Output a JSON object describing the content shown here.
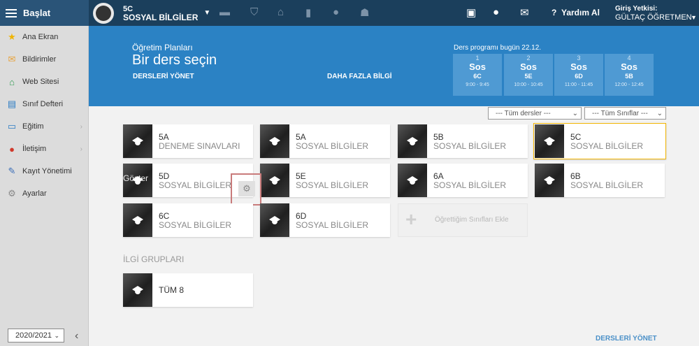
{
  "brand": {
    "label": "Başlat"
  },
  "header": {
    "class_code": "5C",
    "class_subject": "SOSYAL BİLGİLER",
    "help_label": "Yardım Al",
    "user_role": "Giriş Yetkisi:",
    "user_name": "GÜLTAÇ ÖĞRETMEN"
  },
  "sidebar": {
    "items": [
      {
        "label": "Ana Ekran",
        "icon": "star-icon"
      },
      {
        "label": "Bildirimler",
        "icon": "envelope-icon"
      },
      {
        "label": "Web Sitesi",
        "icon": "home-icon"
      },
      {
        "label": "Sınıf Defteri",
        "icon": "notebook-icon"
      },
      {
        "label": "Eğitim",
        "icon": "book-icon"
      },
      {
        "label": "İletişim",
        "icon": "chat-icon"
      },
      {
        "label": "Kayıt Yönetimi",
        "icon": "pen-icon"
      },
      {
        "label": "Ayarlar",
        "icon": "gear-icon"
      }
    ],
    "year": "2020/2021"
  },
  "banner": {
    "subtitle": "Öğretim Planları",
    "title": "Bir ders seçin",
    "manage_link": "DERSLERİ YÖNET",
    "more_link": "DAHA FAZLA BİLGİ",
    "schedule_title": "Ders programı bugün 22.12.",
    "schedule": [
      {
        "num": "1",
        "subject": "Sos",
        "class": "6C",
        "time": "9:00 - 9:45"
      },
      {
        "num": "2",
        "subject": "Sos",
        "class": "5E",
        "time": "10:00 - 10:45"
      },
      {
        "num": "3",
        "subject": "Sos",
        "class": "6D",
        "time": "11:00 - 11:45"
      },
      {
        "num": "4",
        "subject": "Sos",
        "class": "5B",
        "time": "12:00 - 12:45"
      }
    ]
  },
  "filters": {
    "courses": "--- Tüm dersler ---",
    "classes": "--- Tüm Sınıflar ---"
  },
  "cards": [
    {
      "class": "5A",
      "subject": "DENEME SINAVLARI"
    },
    {
      "class": "5A",
      "subject": "SOSYAL BİLGİLER"
    },
    {
      "class": "5B",
      "subject": "SOSYAL BİLGİLER"
    },
    {
      "class": "5C",
      "subject": "SOSYAL BİLGİLER"
    },
    {
      "class": "5D",
      "subject": "SOSYAL BİLGİLER"
    },
    {
      "class": "5E",
      "subject": "SOSYAL BİLGİLER"
    },
    {
      "class": "6A",
      "subject": "SOSYAL BİLGİLER"
    },
    {
      "class": "6B",
      "subject": "SOSYAL BİLGİLER"
    },
    {
      "class": "6C",
      "subject": "SOSYAL BİLGİLER"
    },
    {
      "class": "6D",
      "subject": "SOSYAL BİLGİLER"
    }
  ],
  "show_label": "Göster",
  "add_card_label": "Öğrettiğim Sınıfları Ekle",
  "interest_groups": {
    "title": "İLGİ GRUPLARI",
    "cards": [
      {
        "class": "TÜM 8"
      }
    ]
  },
  "footer_link": "DERSLERİ YÖNET"
}
